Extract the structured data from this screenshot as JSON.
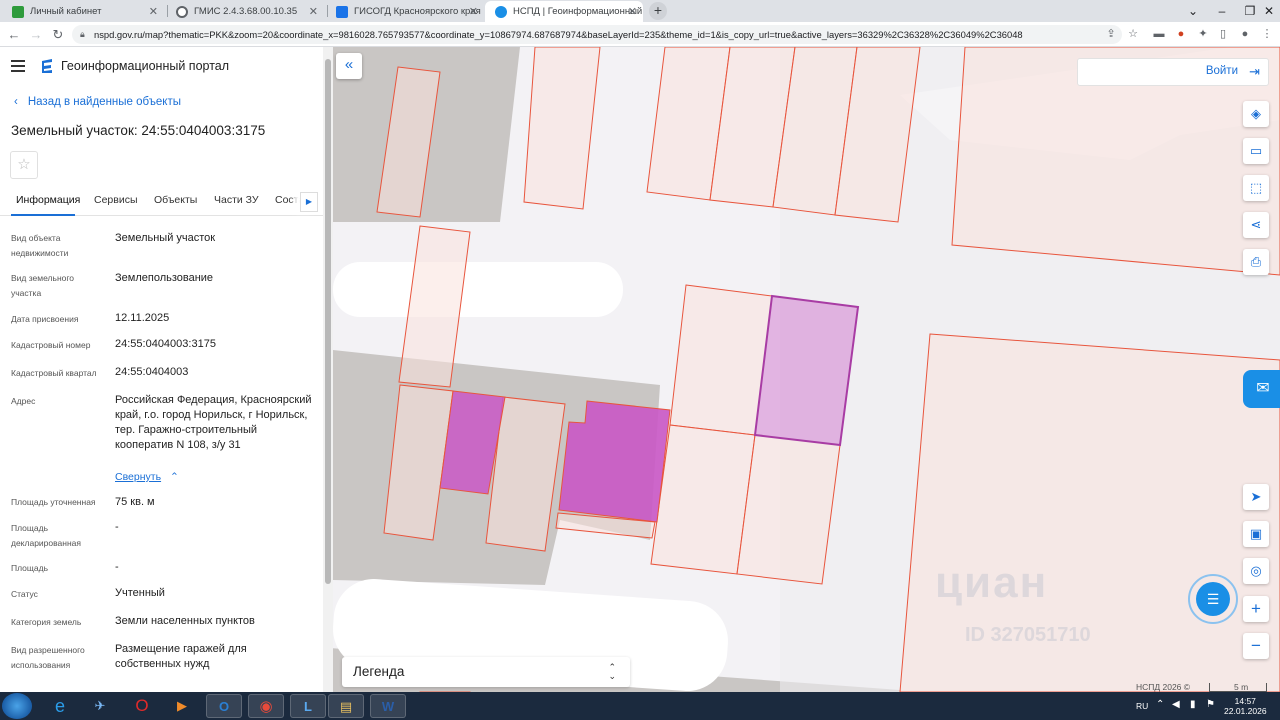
{
  "browser": {
    "tabs": [
      {
        "title": "Личный кабинет",
        "favicon_color": "#2e9b3c"
      },
      {
        "title": "ГМИС 2.4.3.68.00.10.35",
        "favicon_color": "#5f6368"
      },
      {
        "title": "ГИСОГД Красноярского края",
        "favicon_color": "#1a73e8"
      },
      {
        "title": "НСПД | Геоинформационный п",
        "favicon_color": "#1a8fe6"
      }
    ],
    "active_tab": 3,
    "new_tab": "+",
    "url": "nspd.gov.ru/map?thematic=PKK&zoom=20&coordinate_x=9816028.765793577&coordinate_y=10867974.687687974&baseLayerId=235&theme_id=1&is_copy_url=true&active_layers=36329%2C36328%2C36049%2C36048"
  },
  "header": {
    "portal_title": "Геоинформационный портал",
    "back_label": "Назад в найденные объекты",
    "object_title": "Земельный участок: 24:55:0404003:3175"
  },
  "tabs": [
    "Информация",
    "Сервисы",
    "Объекты",
    "Части ЗУ",
    "Соста"
  ],
  "details": [
    {
      "label": "Вид объекта недвижимости",
      "value": "Земельный участок"
    },
    {
      "label": "Вид земельного участка",
      "value": "Землепользование"
    },
    {
      "label": "Дата присвоения",
      "value": "12.11.2025"
    },
    {
      "label": "Кадастровый номер",
      "value": "24:55:0404003:3175"
    },
    {
      "label": "Кадастровый квартал",
      "value": "24:55:0404003"
    },
    {
      "label": "Адрес",
      "value": "Российская Федерация, Красноярский край, г.о. город Норильск, г Норильск, тер. Гаражно-строительный кооператив N 108, з/у 31"
    },
    {
      "label": "Площадь уточненная",
      "value": "75 кв. м"
    },
    {
      "label": "Площадь декларированная",
      "value": "-"
    },
    {
      "label": "Площадь",
      "value": "-"
    },
    {
      "label": "Статус",
      "value": "Учтенный"
    },
    {
      "label": "Категория земель",
      "value": "Земли населенных пунктов"
    },
    {
      "label": "Вид разрешенного использования",
      "value": "Размещение гаражей для собственных нужд"
    }
  ],
  "collapse_label": "Свернуть",
  "map": {
    "login_label": "Войти",
    "legend_label": "Легенда",
    "watermark_text": "циан",
    "watermark_id": "ID 327051710",
    "copyright": "НСПД 2026 ©",
    "scale": "5 m",
    "colors": {
      "parcel_stroke": "#e8553d",
      "parcel_fill": "#f9e1dd",
      "selected": "#c957c5",
      "highlight": "#a83ca4",
      "building": "#c9c6c4",
      "accent": "#1a6fd6"
    }
  },
  "taskbar": {
    "lang": "RU",
    "time": "14:57",
    "date": "22.01.2026"
  }
}
